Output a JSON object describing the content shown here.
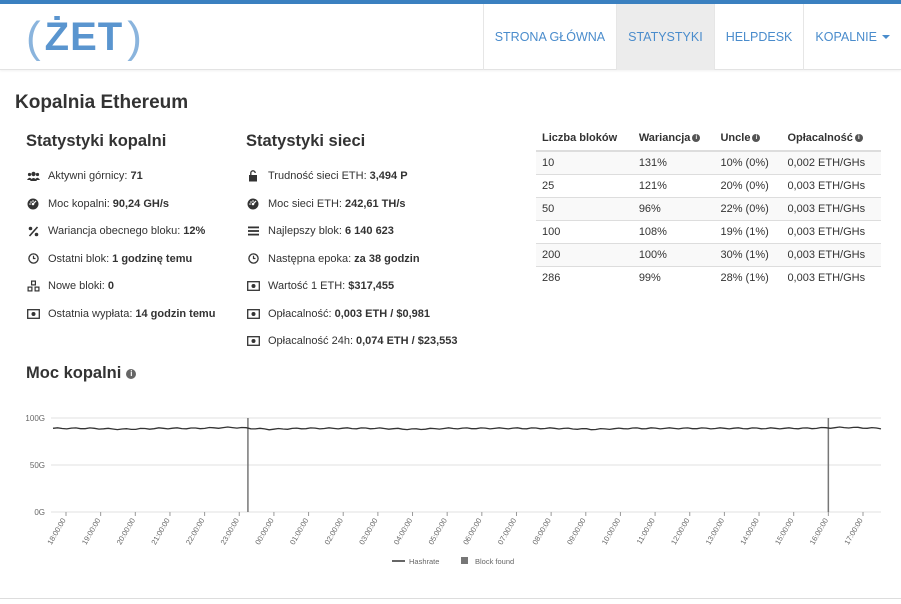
{
  "brand": {
    "logo_word": "ŻET"
  },
  "nav": {
    "items": [
      {
        "label": "STRONA GŁÓWNA",
        "active": false
      },
      {
        "label": "STATYSTYKI",
        "active": true
      },
      {
        "label": "HELPDESK",
        "active": false
      },
      {
        "label": "KOPALNIE",
        "active": false,
        "dropdown": true
      }
    ]
  },
  "page": {
    "title": "Kopalnia Ethereum"
  },
  "pool_stats": {
    "title": "Statystyki kopalni",
    "items": [
      {
        "icon": "users-icon",
        "label": "Aktywni górnicy:",
        "value": "71"
      },
      {
        "icon": "gauge-icon",
        "label": "Moc kopalni:",
        "value": "90,24 GH/s"
      },
      {
        "icon": "percent-icon",
        "label": "Wariancja obecnego bloku:",
        "value": "12%"
      },
      {
        "icon": "clock-icon",
        "label": "Ostatni blok:",
        "value": "1 godzinę temu"
      },
      {
        "icon": "cubes-icon",
        "label": "Nowe bloki:",
        "value": "0"
      },
      {
        "icon": "money-icon",
        "label": "Ostatnia wypłata:",
        "value": "14 godzin temu"
      }
    ]
  },
  "network_stats": {
    "title": "Statystyki sieci",
    "items": [
      {
        "icon": "lock-icon",
        "label": "Trudność sieci ETH:",
        "value": "3,494 P"
      },
      {
        "icon": "gauge-icon",
        "label": "Moc sieci ETH:",
        "value": "242,61 TH/s"
      },
      {
        "icon": "bars-icon",
        "label": "Najlepszy blok:",
        "value": "6 140 623"
      },
      {
        "icon": "clock-icon",
        "label": "Następna epoka:",
        "value": "za 38 godzin"
      },
      {
        "icon": "money-icon",
        "label": "Wartość 1 ETH:",
        "value": "$317,455"
      },
      {
        "icon": "money-icon",
        "label": "Opłacalność:",
        "value": "0,003 ETH / $0,981"
      },
      {
        "icon": "money-icon",
        "label": "Opłacalność 24h:",
        "value": "0,074 ETH / $23,553"
      }
    ]
  },
  "blocks_table": {
    "headers": [
      "Liczba bloków",
      "Wariancja",
      "Uncle",
      "Opłacalność"
    ],
    "header_info": [
      false,
      true,
      true,
      true
    ],
    "rows": [
      [
        "10",
        "131%",
        "10% (0%)",
        "0,002 ETH/GHs"
      ],
      [
        "25",
        "121%",
        "20% (0%)",
        "0,003 ETH/GHs"
      ],
      [
        "50",
        "96%",
        "22% (0%)",
        "0,003 ETH/GHs"
      ],
      [
        "100",
        "108%",
        "19% (1%)",
        "0,003 ETH/GHs"
      ],
      [
        "200",
        "100%",
        "30% (1%)",
        "0,003 ETH/GHs"
      ],
      [
        "286",
        "99%",
        "28% (1%)",
        "0,003 ETH/GHs"
      ]
    ]
  },
  "chart_section": {
    "title": "Moc kopalni"
  },
  "chart_data": {
    "type": "line",
    "y_ticks": [
      "100G",
      "50G",
      "0G"
    ],
    "ylim": [
      0,
      100
    ],
    "x": [
      "18:00:00",
      "19:00:00",
      "20:00:00",
      "21:00:00",
      "22:00:00",
      "23:00:00",
      "00:00:00",
      "01:00:00",
      "02:00:00",
      "03:00:00",
      "04:00:00",
      "05:00:00",
      "06:00:00",
      "07:00:00",
      "08:00:00",
      "09:00:00",
      "10:00:00",
      "11:00:00",
      "12:00:00",
      "13:00:00",
      "14:00:00",
      "15:00:00",
      "16:00:00",
      "17:00:00"
    ],
    "series": [
      {
        "name": "Hashrate",
        "values": [
          89,
          89,
          88,
          89,
          89,
          90,
          88,
          89,
          89,
          89,
          88,
          89,
          89,
          89,
          89,
          88,
          89,
          89,
          89,
          89,
          89,
          89,
          90,
          89
        ]
      }
    ],
    "block_found_label": "Block found",
    "blocks_found_at": [
      "23:15:00",
      "16:00:00"
    ],
    "grid": true,
    "legend": "bottom-center",
    "colors": {
      "line": "#333333",
      "block": "#777777",
      "grid": "#e0e0e0"
    }
  }
}
